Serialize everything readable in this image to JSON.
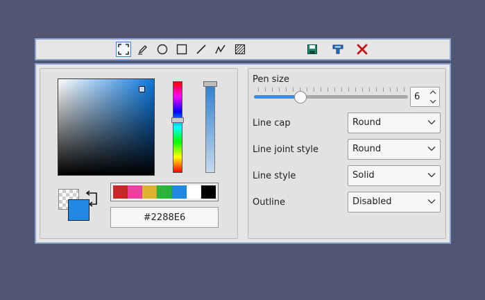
{
  "toolbar": {
    "tools": [
      {
        "name": "selection-tool",
        "icon": "selection-icon",
        "active": true
      },
      {
        "name": "pencil-tool",
        "icon": "pencil-icon",
        "active": false
      },
      {
        "name": "ellipse-tool",
        "icon": "circle-icon",
        "active": false
      },
      {
        "name": "rectangle-tool",
        "icon": "square-icon",
        "active": false
      },
      {
        "name": "line-tool",
        "icon": "line-icon",
        "active": false
      },
      {
        "name": "polyline-tool",
        "icon": "polyline-icon",
        "active": false
      },
      {
        "name": "fill-pattern-tool",
        "icon": "hatch-icon",
        "active": false
      }
    ],
    "actions": [
      {
        "name": "save-button",
        "icon": "floppy-disk-icon"
      },
      {
        "name": "stamp-button",
        "icon": "stamp-icon"
      },
      {
        "name": "close-button",
        "icon": "close-x-icon"
      }
    ]
  },
  "color_picker": {
    "hex_value": "#2288E6",
    "current_color": "#2288E6",
    "palette": [
      "#C62828",
      "#EC3FA0",
      "#DDB22E",
      "#2BB33C",
      "#2288E6",
      "#FFFFFF",
      "#000000"
    ]
  },
  "pen": {
    "size_label": "Pen size",
    "size_value": "6",
    "size_fraction": 0.3
  },
  "options": [
    {
      "key": "line-cap",
      "label": "Line cap",
      "value": "Round"
    },
    {
      "key": "line-joint-style",
      "label": "Line joint style",
      "value": "Round"
    },
    {
      "key": "line-style",
      "label": "Line style",
      "value": "Solid"
    },
    {
      "key": "outline",
      "label": "Outline",
      "value": "Disabled"
    }
  ]
}
